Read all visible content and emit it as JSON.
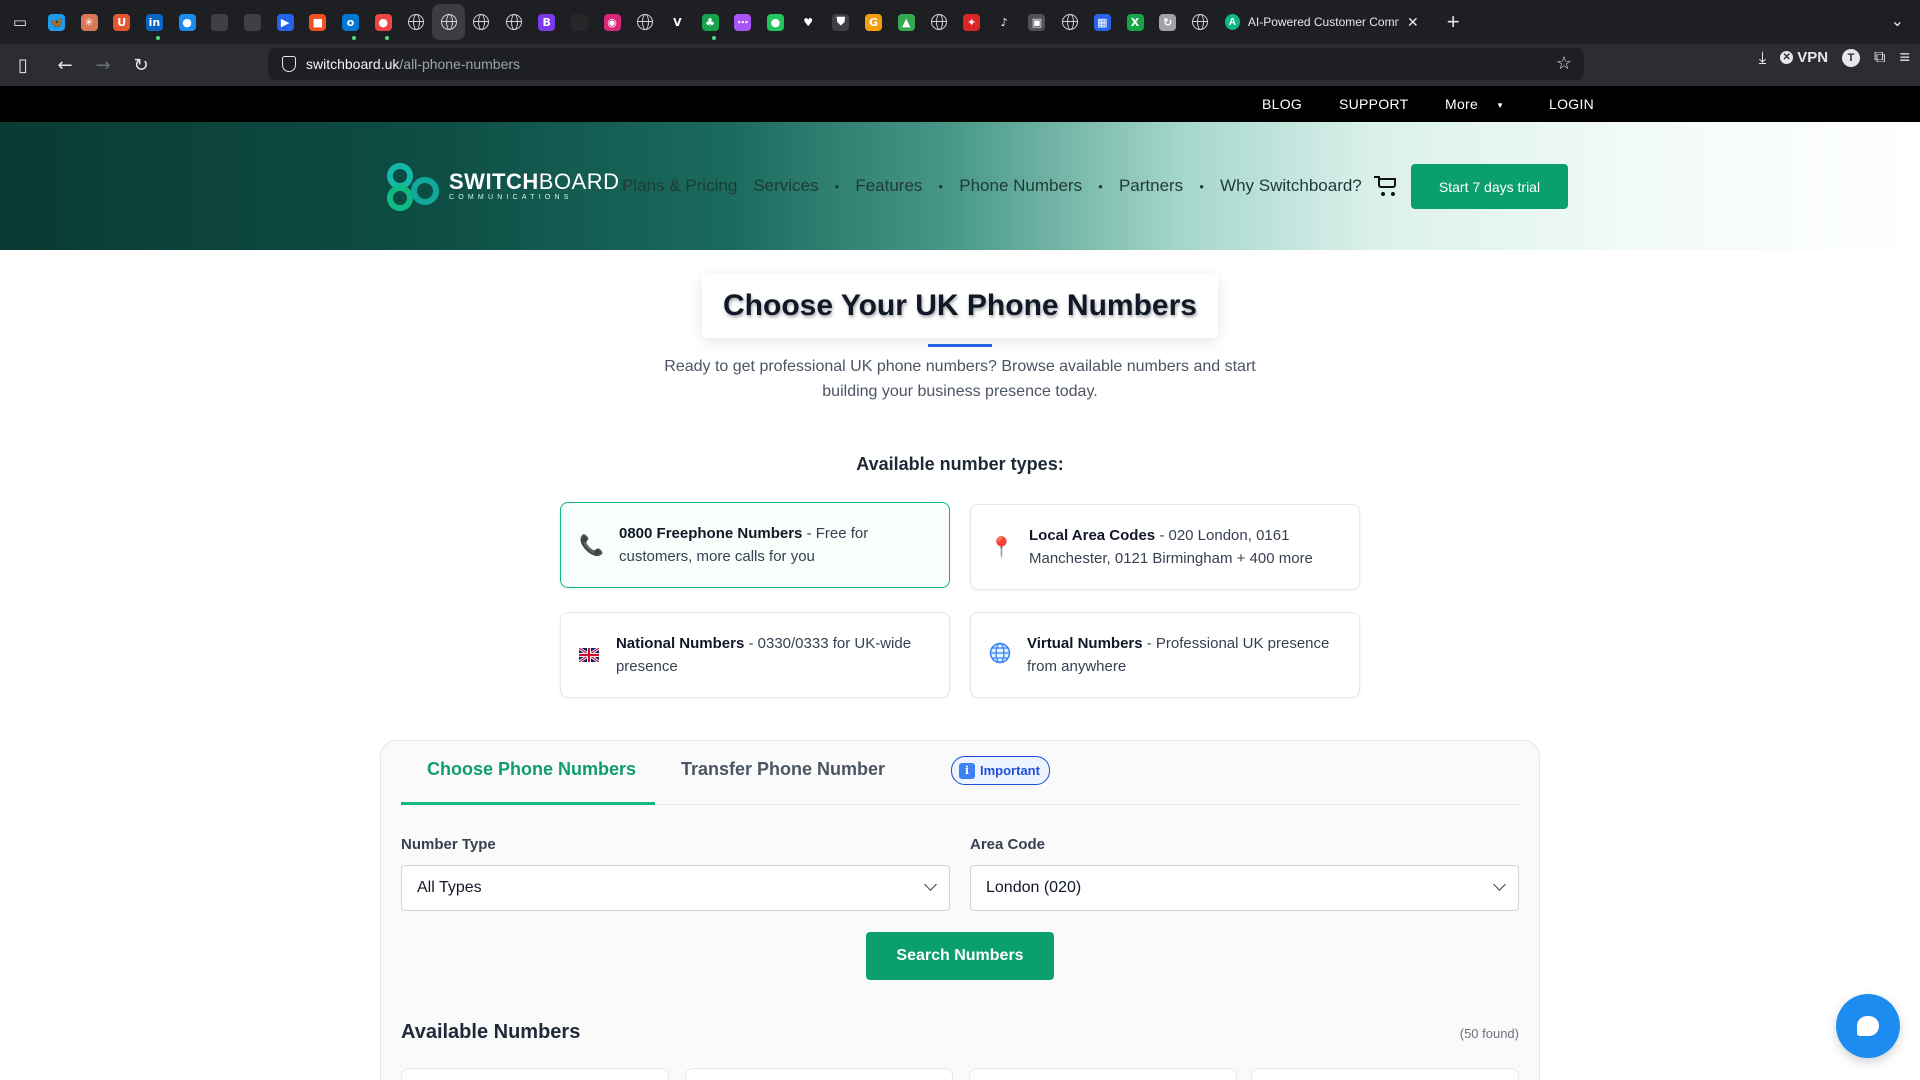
{
  "browser": {
    "active_tab_title": "AI-Powered Customer Communi",
    "url_domain": "switchboard.uk",
    "url_path": "/all-phone-numbers",
    "vpn_label": "VPN",
    "profile_initial": "T",
    "pinned_tabs": [
      {
        "icon": "bluesky-icon",
        "color": "#1d9bf0",
        "glyph": "🦋"
      },
      {
        "icon": "claude-icon",
        "color": "#d97757",
        "glyph": "✳"
      },
      {
        "icon": "u-icon",
        "color": "#e4572e",
        "glyph": "U"
      },
      {
        "icon": "linkedin-icon",
        "color": "#0a66c2",
        "glyph": "in"
      },
      {
        "icon": "circle-icon",
        "color": "#1d8cf0",
        "glyph": "●"
      },
      {
        "icon": "apple-icon",
        "color": "#3f3f46",
        "glyph": ""
      },
      {
        "icon": "apple-icon",
        "color": "#3f3f46",
        "glyph": ""
      },
      {
        "icon": "flag-icon",
        "color": "#2563eb",
        "glyph": "▶"
      },
      {
        "icon": "microsoft-icon",
        "color": "#f25022",
        "glyph": "■"
      },
      {
        "icon": "outlook-icon",
        "color": "#0078d4",
        "glyph": "o"
      },
      {
        "icon": "fire-icon",
        "color": "#ef4444",
        "glyph": "●"
      },
      {
        "icon": "globe-icon",
        "color": "",
        "glyph": ""
      },
      {
        "icon": "globe-icon",
        "color": "",
        "glyph": ""
      },
      {
        "icon": "globe-icon",
        "color": "",
        "glyph": ""
      },
      {
        "icon": "globe-icon",
        "color": "",
        "glyph": ""
      },
      {
        "icon": "b-icon",
        "color": "#7c3aed",
        "glyph": "B"
      },
      {
        "icon": "dark-icon",
        "color": "#27272a",
        "glyph": ""
      },
      {
        "icon": "ring-icon",
        "color": "#db2777",
        "glyph": "◉"
      },
      {
        "icon": "globe-icon",
        "color": "",
        "glyph": ""
      },
      {
        "icon": "v-icon",
        "color": "#ffffff",
        "glyph": "V"
      },
      {
        "icon": "leaf-icon",
        "color": "#16a34a",
        "glyph": "♣"
      },
      {
        "icon": "dots-icon",
        "color": "#a855f7",
        "glyph": "⋯"
      },
      {
        "icon": "green-circle-icon",
        "color": "#22c55e",
        "glyph": "●"
      },
      {
        "icon": "heart-icon",
        "color": "#ffffff",
        "glyph": "♥"
      },
      {
        "icon": "shield-icon",
        "color": "#3f3f46",
        "glyph": "⛊"
      },
      {
        "icon": "g-icon",
        "color": "#f59e0b",
        "glyph": "G"
      },
      {
        "icon": "drive-icon",
        "color": "#34a853",
        "glyph": "▲"
      },
      {
        "icon": "globe-icon",
        "color": "",
        "glyph": ""
      },
      {
        "icon": "puzzle-icon",
        "color": "#dc2626",
        "glyph": "✦"
      },
      {
        "icon": "tiktok-icon",
        "color": "#ffffff",
        "glyph": "♪"
      },
      {
        "icon": "box-icon",
        "color": "#52525b",
        "glyph": "▣"
      },
      {
        "icon": "globe-icon",
        "color": "",
        "glyph": ""
      },
      {
        "icon": "grid-icon",
        "color": "#2563eb",
        "glyph": "▦"
      },
      {
        "icon": "excel-icon",
        "color": "#16a34a",
        "glyph": "X"
      },
      {
        "icon": "chart-icon",
        "color": "#a1a1aa",
        "glyph": "↻"
      },
      {
        "icon": "globe-icon",
        "color": "",
        "glyph": ""
      }
    ]
  },
  "topbar": {
    "blog": "BLOG",
    "support": "SUPPORT",
    "more": "More",
    "login": "LOGIN"
  },
  "header": {
    "logo_main": "SWITCH",
    "logo_main_light": "BOARD",
    "logo_sub": "COMMUNICATIONS",
    "nav": {
      "plans": "Plans & Pricing",
      "services": "Services",
      "features": "Features",
      "phone_numbers": "Phone Numbers",
      "partners": "Partners",
      "why": "Why Switchboard?"
    },
    "trial_button": "Start 7 days trial"
  },
  "hero": {
    "title": "Choose Your UK Phone Numbers",
    "subtitle": "Ready to get professional UK phone numbers? Browse available numbers and start building your business presence today."
  },
  "types": {
    "heading": "Available number types:",
    "items": [
      {
        "name": "0800 Freephone Numbers",
        "desc": " - Free for customers, more calls for you"
      },
      {
        "name": "Local Area Codes",
        "desc": " - 020 London, 0161 Manchester, 0121 Birmingham + 400 more"
      },
      {
        "name": "National Numbers",
        "desc": " - 0330/0333 for UK-wide presence"
      },
      {
        "name": "Virtual Numbers",
        "desc": " - Professional UK presence from anywhere"
      }
    ]
  },
  "panel": {
    "tab_choose": "Choose Phone Numbers",
    "tab_transfer": "Transfer Phone Number",
    "important": "Important",
    "number_type_label": "Number Type",
    "number_type_value": "All Types",
    "area_code_label": "Area Code",
    "area_code_value": "London (020)",
    "search_button": "Search Numbers",
    "available_title": "Available Numbers",
    "available_count": "(50 found)"
  }
}
